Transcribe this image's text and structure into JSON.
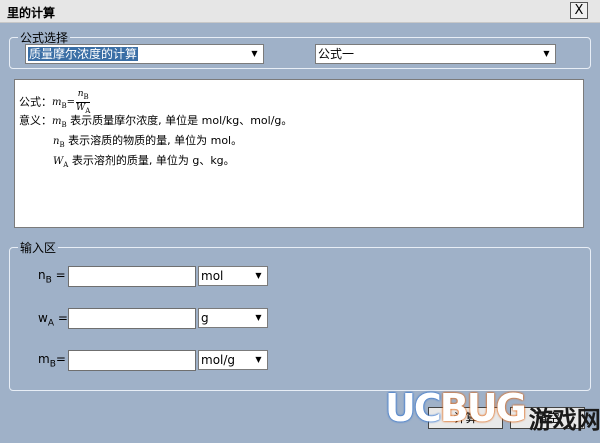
{
  "window": {
    "title": "里的计算",
    "close_label": "X"
  },
  "formula_group": {
    "label": "公式选择",
    "select_calc": {
      "value": "质量摩尔浓度的计算"
    },
    "select_formula": {
      "value": "公式一"
    }
  },
  "description": {
    "formula_prefix": "公式：",
    "formula_lhs": "m",
    "formula_lhs_sub": "B",
    "formula_eq": "=",
    "formula_num": "n",
    "formula_num_sub": "B",
    "formula_den": "W",
    "formula_den_sub": "A",
    "meaning_label": "意义：",
    "lines": [
      {
        "sym": "m",
        "sub": "B",
        "text": "表示质量摩尔浓度, 单位是 mol/kg、mol/g。"
      },
      {
        "sym": "n",
        "sub": "B",
        "text": "表示溶质的物质的量, 单位为 mol。"
      },
      {
        "sym": "W",
        "sub": "A",
        "text": "表示溶剂的质量, 单位为 g、kg。"
      }
    ]
  },
  "input_group": {
    "label": "输入区",
    "fields": [
      {
        "var": "n",
        "sub": "B",
        "eq": " =",
        "value": "",
        "unit": "mol"
      },
      {
        "var": "w",
        "sub": "A",
        "eq": " =",
        "value": "",
        "unit": "g"
      },
      {
        "var": "m",
        "sub": "B",
        "eq": "=",
        "value": "",
        "unit": "mol/g"
      }
    ]
  },
  "buttons": {
    "calculate": "计算",
    "clear": "清空"
  },
  "watermark": {
    "uc": "UC",
    "bug": "BUG",
    "cn": "游戏网"
  }
}
